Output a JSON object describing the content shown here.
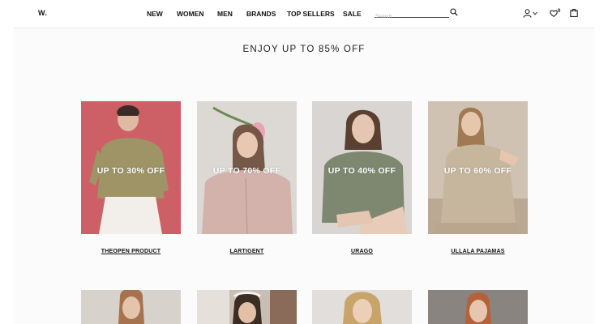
{
  "header": {
    "logo": "W.",
    "nav": [
      "NEW",
      "WOMEN",
      "MEN",
      "BRANDS",
      "TOP SELLERS",
      "SALE"
    ],
    "search_placeholder": "Search",
    "wishlist_count": "0",
    "icons": [
      "search-icon",
      "user-icon",
      "chevron-down-icon",
      "heart-icon",
      "bag-icon"
    ]
  },
  "promo": {
    "title": "ENJOY UP TO 85% OFF"
  },
  "cards": [
    {
      "discount": "UP TO 30% OFF",
      "brand": "THEOPEN PRODUCT",
      "bg": "#cd5f66"
    },
    {
      "discount": "UP TO 70%  OFF",
      "brand": "LARTIGENT",
      "bg": "#d9d4cf"
    },
    {
      "discount": "UP TO 40%  OFF",
      "brand": "URAGO",
      "bg": "#d8d5d2"
    },
    {
      "discount": "UP TO 60% OFF",
      "brand": "ULLALA PAJAMAS",
      "bg": "#cfc2b2"
    }
  ],
  "cards_row2_bg": [
    "#d8d2cc",
    "#8a6a58",
    "#e1dedb",
    "#8a8480"
  ],
  "colors": {
    "text": "#111111",
    "background": "#fbfbfb"
  }
}
